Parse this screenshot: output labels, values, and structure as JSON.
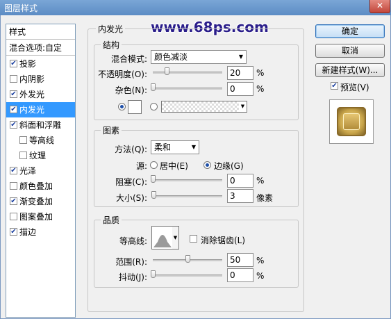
{
  "window": {
    "title": "图层样式",
    "close_glyph": "✕"
  },
  "watermark": "www.68ps.com",
  "styles_list": {
    "header": "样式",
    "blend_options": "混合选项:自定",
    "items": [
      {
        "label": "投影",
        "checked": true,
        "indent": false,
        "selected": false
      },
      {
        "label": "内阴影",
        "checked": false,
        "indent": false,
        "selected": false
      },
      {
        "label": "外发光",
        "checked": true,
        "indent": false,
        "selected": false
      },
      {
        "label": "内发光",
        "checked": true,
        "indent": false,
        "selected": true
      },
      {
        "label": "斜面和浮雕",
        "checked": true,
        "indent": false,
        "selected": false
      },
      {
        "label": "等高线",
        "checked": false,
        "indent": true,
        "selected": false
      },
      {
        "label": "纹理",
        "checked": false,
        "indent": true,
        "selected": false
      },
      {
        "label": "光泽",
        "checked": true,
        "indent": false,
        "selected": false
      },
      {
        "label": "颜色叠加",
        "checked": false,
        "indent": false,
        "selected": false
      },
      {
        "label": "渐变叠加",
        "checked": true,
        "indent": false,
        "selected": false
      },
      {
        "label": "图案叠加",
        "checked": false,
        "indent": false,
        "selected": false
      },
      {
        "label": "描边",
        "checked": true,
        "indent": false,
        "selected": false
      }
    ]
  },
  "inner_glow": {
    "title": "内发光",
    "structure": {
      "title": "结构",
      "blend_mode_label": "混合模式:",
      "blend_mode_value": "颜色减淡",
      "opacity_label": "不透明度(O):",
      "opacity_value": "20",
      "opacity_fraction": 0.2,
      "noise_label": "杂色(N):",
      "noise_value": "0",
      "noise_fraction": 0.0,
      "percent": "%"
    },
    "elements": {
      "title": "图素",
      "method_label": "方法(Q):",
      "method_value": "柔和",
      "source_label": "源:",
      "source_center": "居中(E)",
      "source_edge": "边缘(G)",
      "choke_label": "阻塞(C):",
      "choke_value": "0",
      "choke_fraction": 0.0,
      "size_label": "大小(S):",
      "size_value": "3",
      "size_fraction": 0.012,
      "percent": "%",
      "pixels": "像素"
    },
    "quality": {
      "title": "品质",
      "contour_label": "等高线:",
      "anti_alias_label": "消除锯齿(L)",
      "range_label": "范围(R):",
      "range_value": "50",
      "range_fraction": 0.5,
      "jitter_label": "抖动(J):",
      "jitter_value": "0",
      "jitter_fraction": 0.0,
      "percent": "%"
    }
  },
  "buttons": {
    "ok": "确定",
    "cancel": "取消",
    "new_style": "新建样式(W)...",
    "preview": "预览(V)"
  },
  "colors": {
    "selected_row": "#3399ff",
    "watermark": "#2a1d8a",
    "preview_gold": "#c9a54a"
  }
}
